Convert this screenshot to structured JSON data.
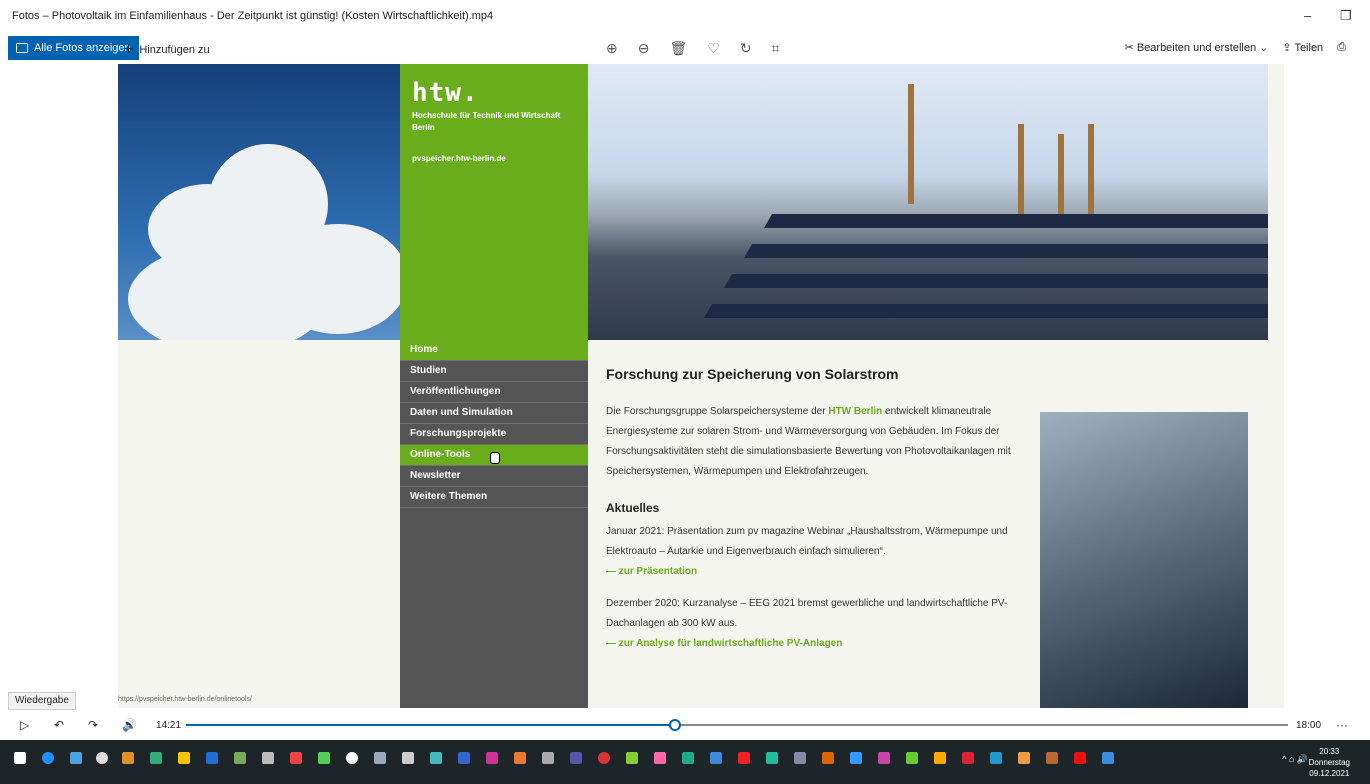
{
  "window": {
    "title": "Fotos – Photovoltaik im Einfamilienhaus - Der Zeitpunkt ist günstig!  (Kosten Wirtschaftlichkeit).mp4",
    "minimize": "–",
    "restore": "❐"
  },
  "toolbar": {
    "all_photos": "Alle Fotos anzeigen",
    "add_to": "Hinzufügen zu",
    "edit_create": "Bearbeiten und erstellen",
    "share": "Teilen"
  },
  "video_frame": {
    "logo": "htw.",
    "institution": "Hochschule für Technik und Wirtschaft Berlin",
    "site_url": "pvspeicher.htw-berlin.de",
    "nav": [
      "Home",
      "Studien",
      "Veröffentlichungen",
      "Daten und Simulation",
      "Forschungsprojekte",
      "Online-Tools",
      "Newsletter",
      "Weitere Themen"
    ],
    "active_nav": "Online-Tools",
    "heading": "Forschung zur Speicherung von Solarstrom",
    "intro_pre": "Die Forschungsgruppe Solarspeichersysteme der ",
    "intro_highlight": "HTW Berlin",
    "intro_post": " entwickelt klimaneutrale Energiesysteme zur solaren Strom- und Wärmeversorgung von Gebäuden. Im Fokus der Forschungsaktivitäten steht die simulationsbasierte Bewertung von Photovoltaikanlagen mit Speichersystemen, Wärmepumpen und Elektrofahrzeugen.",
    "news_heading": "Aktuelles",
    "news1": "Januar 2021: Präsentation zum pv magazine Webinar „Haushaltsstrom, Wärmepumpe und Elektroauto – Autarkie und Eigenverbrauch einfach simulieren“.",
    "news1_link": "— zur Präsentation",
    "news2": "Dezember 2020: Kurzanalyse – EEG 2021 bremst gewerbliche und landwirtschaftliche PV-Dachanlagen ab 300 kW aus.",
    "news2_link": "— zur Analyse für landwirtschaftliche PV-Anlagen",
    "status_url": "https://pvspeicher.htw-berlin.de/onlinetools/"
  },
  "player": {
    "tooltip": "Wiedergabe",
    "current_time": "14:21",
    "duration": "18:00",
    "progress": 0.444,
    "more": "···"
  },
  "taskbar": {
    "time": "20:33",
    "day": "Donnerstag",
    "date": "09.12.2021"
  },
  "colors": {
    "accent": "#0063b1",
    "htw_green": "#6aad1c"
  }
}
